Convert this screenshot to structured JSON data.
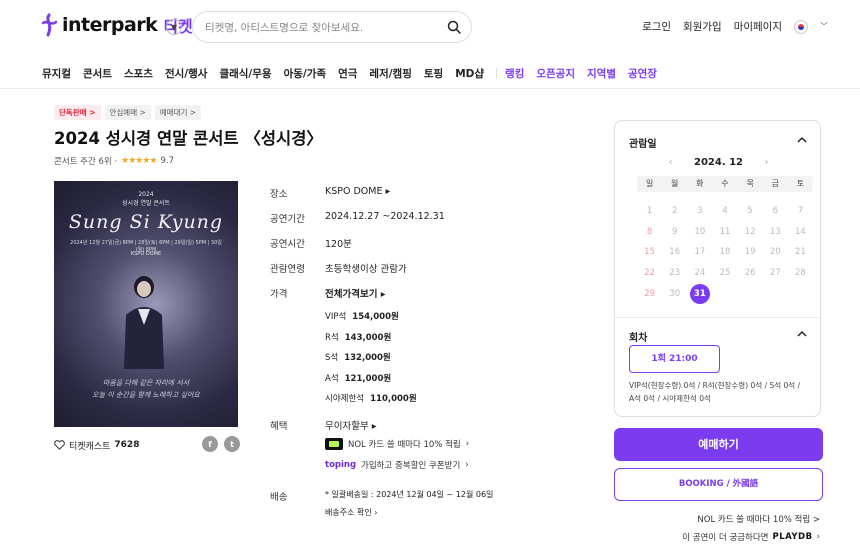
{
  "header": {
    "brand": "interpark",
    "brand_ticket": "티켓",
    "search_placeholder": "티켓명, 아티스트명으로 찾아보세요.",
    "links": [
      "로그인",
      "회원가입",
      "마이페이지"
    ]
  },
  "nav": {
    "items": [
      "뮤지컬",
      "콘서트",
      "스포츠",
      "전시/행사",
      "클래식/무용",
      "아동/가족",
      "연극",
      "레저/캠핑",
      "토핑",
      "MD샵"
    ],
    "purple_items": [
      "랭킹",
      "오픈공지",
      "지역별",
      "공연장"
    ]
  },
  "badges": [
    "단독판매 >",
    "안심예매 >",
    "예매대기 >"
  ],
  "title": "2024 성시경 연말 콘서트 〈성시경〉",
  "rank_text": "콘서트 주간 6위 ·",
  "stars": "★★★★★",
  "rating": "9.7",
  "poster": {
    "top": "2024",
    "sub": "성시경 연말 콘서트",
    "signature": "Sung Si Kyung",
    "info": "2024년 12월 27일(금) 8PM | 28일(토) 6PM | 29일(일) 5PM | 30일(월) 8PM",
    "venue": "KSPO DOME",
    "bottom_line1": "마음을 다해 같은 자리에 서서",
    "bottom_line2": "오늘 이 순간을 함께 노래하고 싶어요"
  },
  "cast_label": "티켓캐스트",
  "cast_count": "7628",
  "info": {
    "venue_label": "장소",
    "venue": "KSPO DOME",
    "period_label": "공연기간",
    "period": "2024.12.27 ~2024.12.31",
    "runtime_label": "공연시간",
    "runtime": "120분",
    "age_label": "관람연령",
    "age": "초등학생이상 관람가",
    "price_label": "가격",
    "price_all": "전체가격보기",
    "prices": [
      {
        "seat": "VIP석",
        "amount": "154,000원"
      },
      {
        "seat": "R석",
        "amount": "143,000원"
      },
      {
        "seat": "S석",
        "amount": "132,000원"
      },
      {
        "seat": "A석",
        "amount": "121,000원"
      },
      {
        "seat": "시야제한석",
        "amount": "110,000원"
      }
    ],
    "benefit_label": "혜택",
    "benefit": "무이자할부",
    "nol_text": "NOL 카드 쓸 때마다 10% 적립",
    "toping_logo": "toping",
    "toping_text": "가입하고 중복할인 쿠폰받기",
    "delivery_label": "배송",
    "delivery": "* 일괄배송일 : 2024년 12월 04일 ~ 12월 06일",
    "delivery_check": "배송주소 확인"
  },
  "calendar": {
    "header": "관람일",
    "month": "2024. 12",
    "weekdays": [
      "일",
      "월",
      "화",
      "수",
      "목",
      "금",
      "토"
    ],
    "days": [
      1,
      2,
      3,
      4,
      5,
      6,
      7,
      8,
      9,
      10,
      11,
      12,
      13,
      14,
      15,
      16,
      17,
      18,
      19,
      20,
      21,
      22,
      23,
      24,
      25,
      26,
      27,
      28,
      29,
      30,
      31
    ],
    "selected_day": 31
  },
  "session": {
    "header": "회차",
    "slot": "1회 21:00",
    "seats_line1": "VIP석(현장수령) 0석 / R석(현장수령) 0석 / S석 0석 /",
    "seats_line2": "A석 0석 / 시야제한석 0석"
  },
  "buttons": {
    "book": "예매하기",
    "foreign": "BOOKING / 外國語"
  },
  "promo": "NOL 카드 쓸 때마다 10% 적립 >",
  "playdb_text": "이 공연이 더 궁금하다면",
  "playdb_logo": "PLAYDB",
  "colors": {
    "accent": "#7b3cf0",
    "sunday": "#f29ca5",
    "star": "#f5a623"
  }
}
